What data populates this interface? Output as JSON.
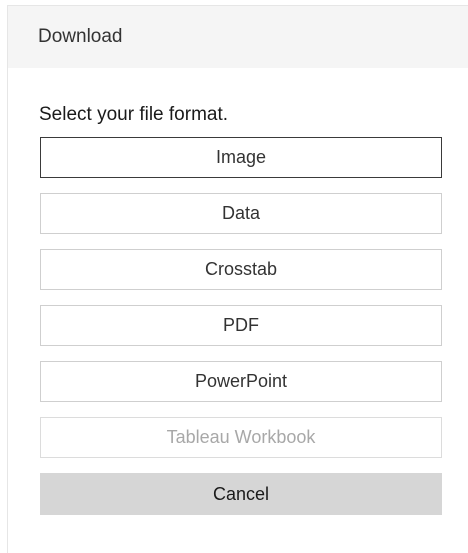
{
  "dialog": {
    "title": "Download",
    "prompt": "Select your file format."
  },
  "formats": [
    {
      "label": "Image",
      "state": "selected"
    },
    {
      "label": "Data",
      "state": "enabled"
    },
    {
      "label": "Crosstab",
      "state": "enabled"
    },
    {
      "label": "PDF",
      "state": "enabled"
    },
    {
      "label": "PowerPoint",
      "state": "enabled"
    },
    {
      "label": "Tableau Workbook",
      "state": "disabled"
    }
  ],
  "actions": {
    "cancel_label": "Cancel"
  },
  "colors": {
    "header_bg": "#f5f5f5",
    "cancel_bg": "#d6d6d6",
    "disabled_text": "#a8a8a8"
  }
}
